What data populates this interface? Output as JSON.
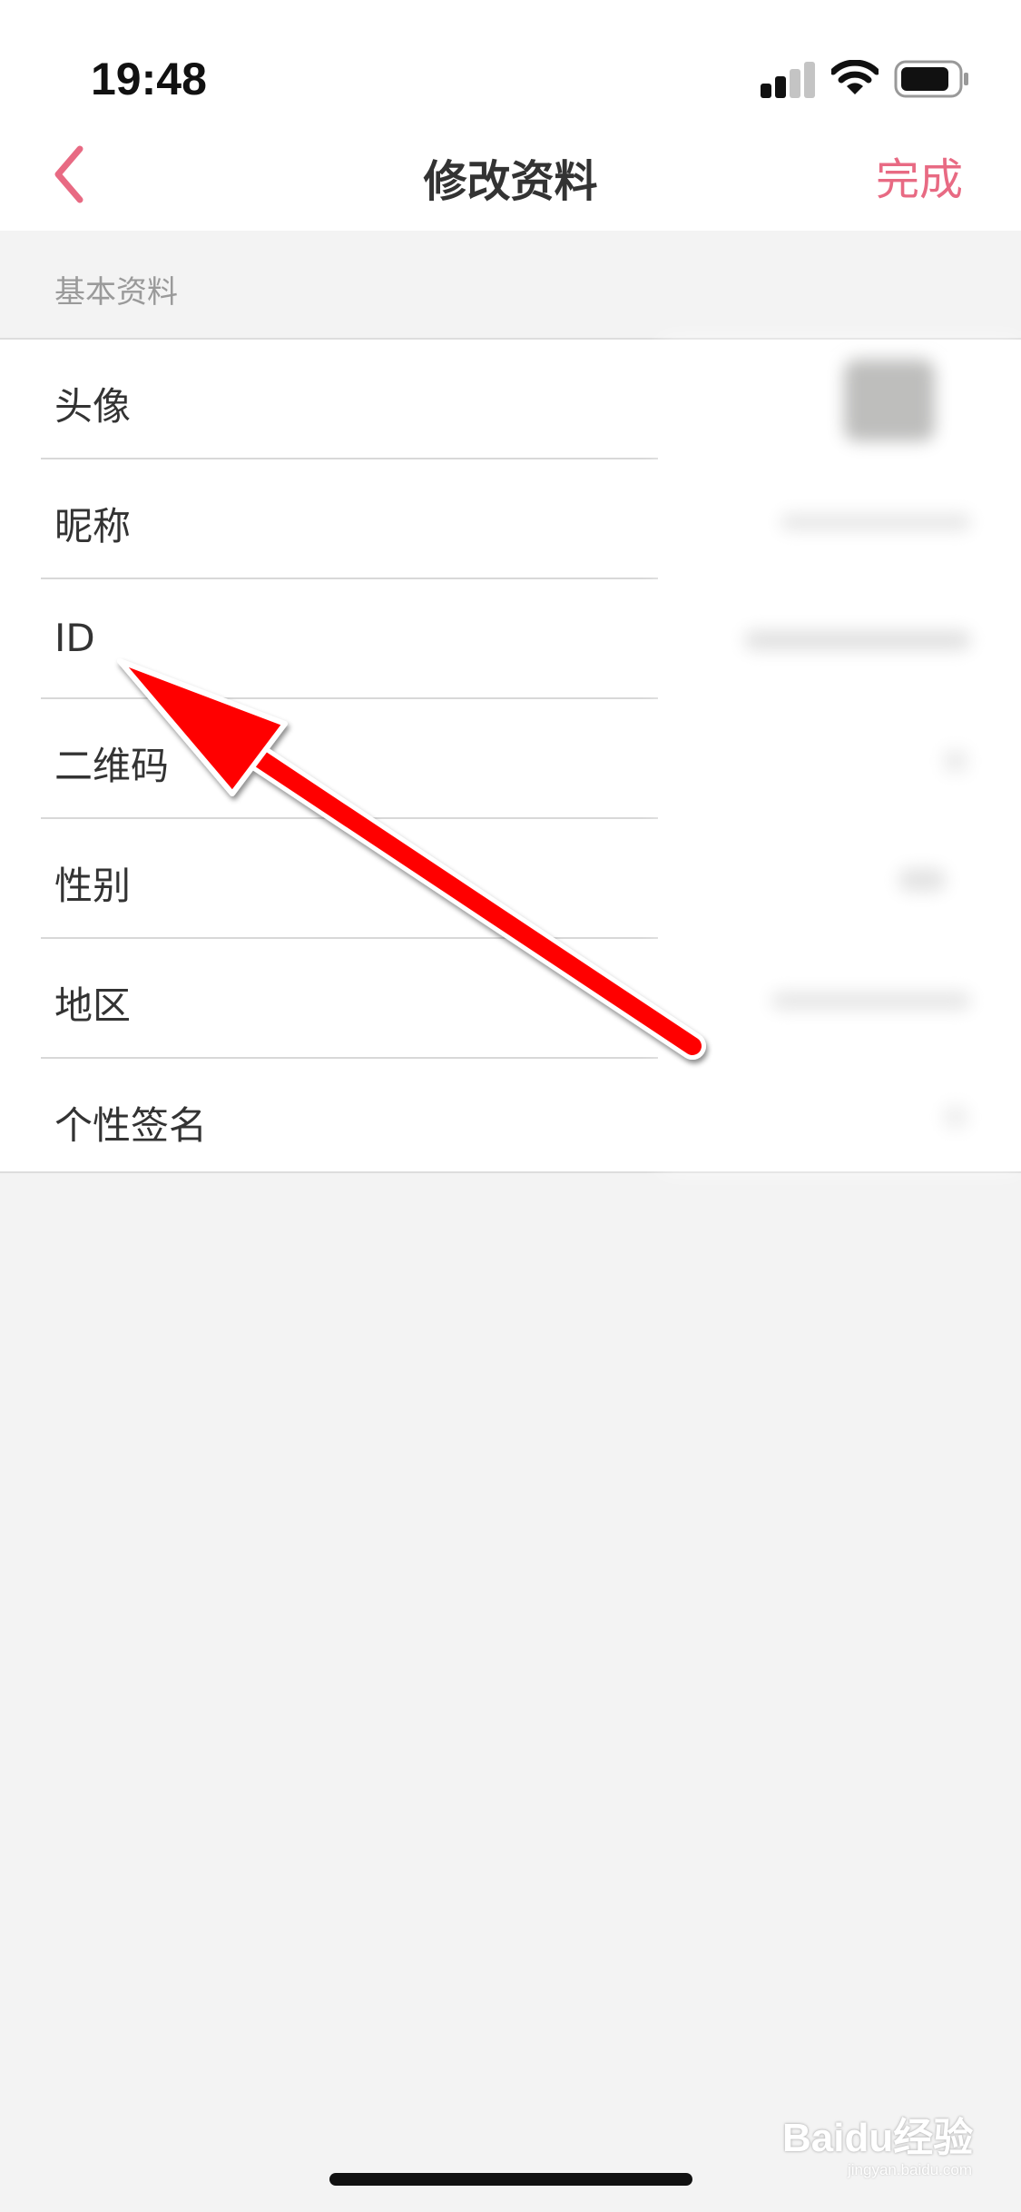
{
  "status_bar": {
    "time": "19:48",
    "icons": [
      "signal-icon",
      "wifi-icon",
      "battery-icon"
    ]
  },
  "nav": {
    "back_icon": "chevron-left-icon",
    "title": "修改资料",
    "done_label": "完成"
  },
  "section": {
    "label": "基本资料"
  },
  "items": [
    {
      "label": "头像"
    },
    {
      "label": "昵称"
    },
    {
      "label": "ID"
    },
    {
      "label": "二维码"
    },
    {
      "label": "性别"
    },
    {
      "label": "地区"
    },
    {
      "label": "个性签名"
    }
  ],
  "annotation": {
    "arrow_color": "#ff0000"
  },
  "watermark": {
    "logo": "Baidu经验",
    "url": "jingyan.baidu.com"
  },
  "colors": {
    "accent": "#e86a83",
    "background": "#f3f3f3"
  }
}
